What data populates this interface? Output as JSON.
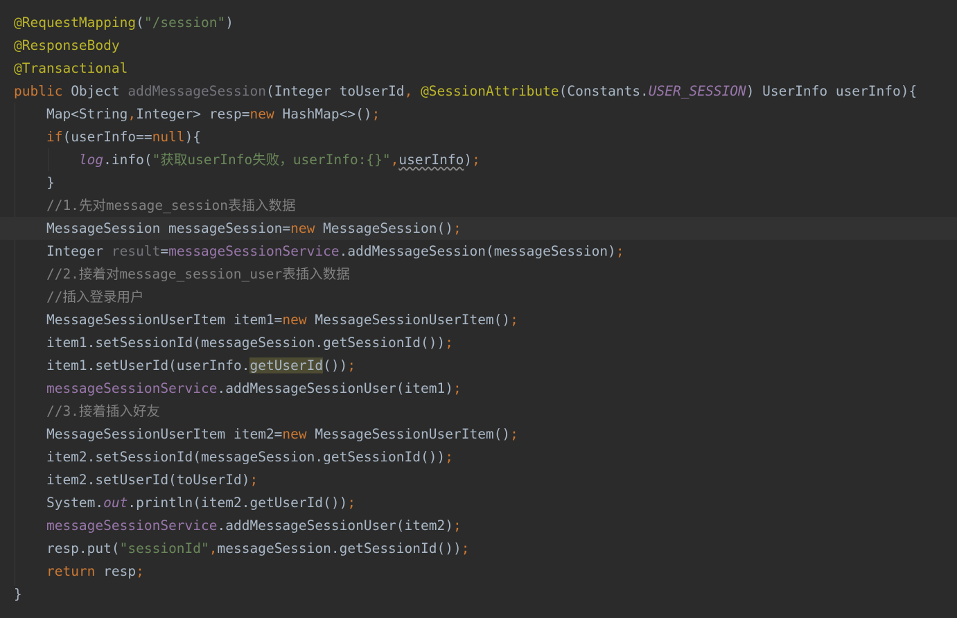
{
  "editor": {
    "colors": {
      "background": "#2b2b2b",
      "text": "#a9b7c6",
      "keyword": "#cc7832",
      "annotation": "#bbb529",
      "string": "#6a8759",
      "comment": "#808080",
      "field": "#9876aa",
      "unused": "#72737a",
      "current_line": "#323232",
      "usage_highlight": "#4d4c33"
    },
    "lines": [
      [
        {
          "t": "@RequestMapping",
          "c": "ann"
        },
        {
          "t": "("
        },
        {
          "t": "\"/session\"",
          "c": "str"
        },
        {
          "t": ")"
        }
      ],
      [
        {
          "t": "@ResponseBody",
          "c": "ann"
        }
      ],
      [
        {
          "t": "@Transactional",
          "c": "ann"
        }
      ],
      [
        {
          "t": "public",
          "c": "kw"
        },
        {
          "t": " Object "
        },
        {
          "t": "addMessageSession",
          "c": "unused"
        },
        {
          "t": "(Integer toUserId"
        },
        {
          "t": ",",
          "c": "kw"
        },
        {
          "t": " "
        },
        {
          "t": "@SessionAttribute",
          "c": "ann"
        },
        {
          "t": "(Constants."
        },
        {
          "t": "USER_SESSION",
          "c": "sfld"
        },
        {
          "t": ") UserInfo userInfo){"
        }
      ],
      [
        {
          "t": "    Map<String"
        },
        {
          "t": ",",
          "c": "kw"
        },
        {
          "t": "Integer> resp="
        },
        {
          "t": "new",
          "c": "kw"
        },
        {
          "t": " HashMap<>()"
        },
        {
          "t": ";",
          "c": "kw"
        }
      ],
      [
        {
          "t": "    "
        },
        {
          "t": "if",
          "c": "kw"
        },
        {
          "t": "(userInfo=="
        },
        {
          "t": "null",
          "c": "kw"
        },
        {
          "t": "){"
        }
      ],
      [
        {
          "t": "        "
        },
        {
          "t": "log",
          "c": "sfld"
        },
        {
          "t": ".info("
        },
        {
          "t": "\"获取userInfo失败，userInfo:{}\"",
          "c": "str"
        },
        {
          "t": ",",
          "c": "kw"
        },
        {
          "t": "userInfo",
          "c": "wavy"
        },
        {
          "t": ")"
        },
        {
          "t": ";",
          "c": "kw"
        }
      ],
      [
        {
          "t": "    }"
        }
      ],
      [
        {
          "t": "    //1.先对message_session表插入数据",
          "c": "cmt"
        }
      ],
      [
        {
          "t": "    MessageSession messageSession="
        },
        {
          "t": "new",
          "c": "kw"
        },
        {
          "t": " MessageSession()"
        },
        {
          "t": ";",
          "c": "kw"
        }
      ],
      [
        {
          "t": "    Integer "
        },
        {
          "t": "result",
          "c": "unused"
        },
        {
          "t": "="
        },
        {
          "t": "messageSessionService",
          "c": "fld"
        },
        {
          "t": ".addMessageSession(messageSession)"
        },
        {
          "t": ";",
          "c": "kw"
        }
      ],
      [
        {
          "t": "    //2.接着对message_session_user表插入数据",
          "c": "cmt"
        }
      ],
      [
        {
          "t": "    //插入登录用户",
          "c": "cmt"
        }
      ],
      [
        {
          "t": "    MessageSessionUserItem item1="
        },
        {
          "t": "new",
          "c": "kw"
        },
        {
          "t": " MessageSessionUserItem()"
        },
        {
          "t": ";",
          "c": "kw"
        }
      ],
      [
        {
          "t": "    item1.setSessionId(messageSession.getSessionId())"
        },
        {
          "t": ";",
          "c": "kw"
        }
      ],
      [
        {
          "t": "    item1.setUserId(userInfo."
        },
        {
          "t": "getUserId",
          "c": "hl"
        },
        {
          "t": "())"
        },
        {
          "t": ";",
          "c": "kw"
        }
      ],
      [
        {
          "t": "    "
        },
        {
          "t": "messageSessionService",
          "c": "fld"
        },
        {
          "t": ".addMessageSessionUser(item1)"
        },
        {
          "t": ";",
          "c": "kw"
        }
      ],
      [
        {
          "t": "    //3.接着插入好友",
          "c": "cmt"
        }
      ],
      [
        {
          "t": "    MessageSessionUserItem item2="
        },
        {
          "t": "new",
          "c": "kw"
        },
        {
          "t": " MessageSessionUserItem()"
        },
        {
          "t": ";",
          "c": "kw"
        }
      ],
      [
        {
          "t": "    item2.setSessionId(messageSession.getSessionId())"
        },
        {
          "t": ";",
          "c": "kw"
        }
      ],
      [
        {
          "t": "    item2.setUserId(toUserId)"
        },
        {
          "t": ";",
          "c": "kw"
        }
      ],
      [
        {
          "t": "    System."
        },
        {
          "t": "out",
          "c": "sfld"
        },
        {
          "t": ".println(item2.getUserId())"
        },
        {
          "t": ";",
          "c": "kw"
        }
      ],
      [
        {
          "t": "    "
        },
        {
          "t": "messageSessionService",
          "c": "fld"
        },
        {
          "t": ".addMessageSessionUser(item2)"
        },
        {
          "t": ";",
          "c": "kw"
        }
      ],
      [
        {
          "t": "    resp.put("
        },
        {
          "t": "\"sessionId\"",
          "c": "str"
        },
        {
          "t": ",",
          "c": "kw"
        },
        {
          "t": "messageSession.getSessionId())"
        },
        {
          "t": ";",
          "c": "kw"
        }
      ],
      [
        {
          "t": "    "
        },
        {
          "t": "return",
          "c": "kw"
        },
        {
          "t": " resp"
        },
        {
          "t": ";",
          "c": "kw"
        }
      ],
      [
        {
          "t": "}"
        }
      ]
    ]
  }
}
